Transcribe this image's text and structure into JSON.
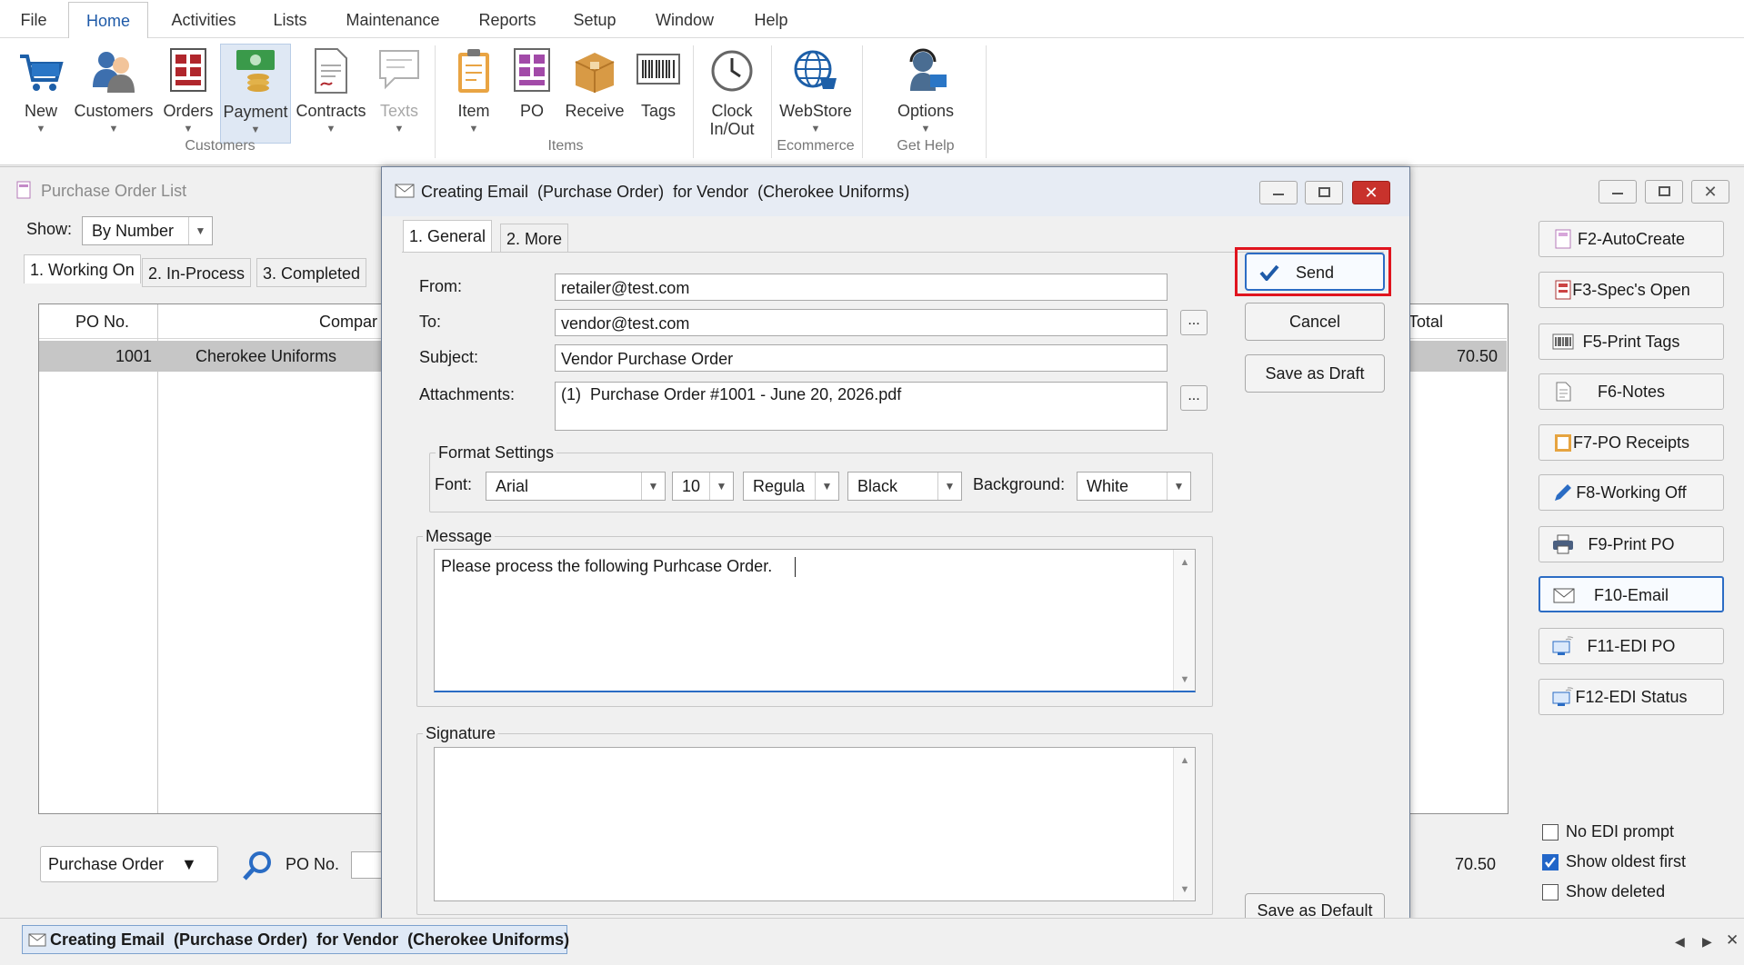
{
  "menu": {
    "items": [
      "File",
      "Home",
      "Activities",
      "Lists",
      "Maintenance",
      "Reports",
      "Setup",
      "Window",
      "Help"
    ],
    "active": "Home"
  },
  "ribbon": {
    "buttons": [
      {
        "label": "New",
        "icon": "cart-icon",
        "dropdown": true
      },
      {
        "label": "Customers",
        "icon": "customers-icon",
        "dropdown": true
      },
      {
        "label": "Orders",
        "icon": "orders-icon",
        "dropdown": true
      },
      {
        "label": "Payment",
        "icon": "payment-icon",
        "dropdown": true,
        "selected": true
      },
      {
        "label": "Contracts",
        "icon": "contracts-icon",
        "dropdown": true
      },
      {
        "label": "Texts",
        "icon": "texts-icon",
        "dropdown": true,
        "disabled": true
      },
      {
        "label": "Item",
        "icon": "item-icon",
        "dropdown": true
      },
      {
        "label": "PO",
        "icon": "po-icon",
        "dropdown": false
      },
      {
        "label": "Receive",
        "icon": "receive-icon",
        "dropdown": false
      },
      {
        "label": "Tags",
        "icon": "barcode-icon",
        "dropdown": false
      },
      {
        "label": "Clock",
        "label2": "In/Out",
        "icon": "clock-icon",
        "dropdown": false
      },
      {
        "label": "WebStore",
        "icon": "webstore-icon",
        "dropdown": true
      },
      {
        "label": "Options",
        "icon": "support-icon",
        "dropdown": true
      }
    ],
    "groups": [
      "Customers",
      "Items",
      "Ecommerce",
      "Get Help"
    ]
  },
  "po_list": {
    "title": "Purchase Order List",
    "show_label": "Show:",
    "show_value": "By Number",
    "tabs": [
      "1. Working On",
      "2. In-Process",
      "3. Completed"
    ],
    "columns": {
      "po_no": "PO No.",
      "company": "Compar",
      "total": "Total"
    },
    "rows": [
      {
        "po_no": "1001",
        "company": "Cherokee Uniforms",
        "total": "70.50"
      }
    ],
    "footer_total": "70.50",
    "search_type": "Purchase Order",
    "search_label": "PO No.",
    "side_buttons": [
      {
        "label": "F2-AutoCreate",
        "icon": "autocreate-icon"
      },
      {
        "label": "F3-Spec's Open",
        "icon": "spec-icon"
      },
      {
        "label": "F5-Print Tags",
        "icon": "barcode-icon"
      },
      {
        "label": "F6-Notes",
        "icon": "notes-icon"
      },
      {
        "label": "F7-PO Receipts",
        "icon": "receipts-icon"
      },
      {
        "label": "F8-Working Off",
        "icon": "pencil-icon"
      },
      {
        "label": "F9-Print PO",
        "icon": "printer-icon"
      },
      {
        "label": "F10-Email",
        "icon": "envelope-icon",
        "active": true
      },
      {
        "label": "F11-EDI PO",
        "icon": "edi-icon"
      },
      {
        "label": "F12-EDI Status",
        "icon": "edi-status-icon"
      }
    ],
    "checkboxes": [
      {
        "label": "No EDI prompt",
        "checked": false
      },
      {
        "label": "Show oldest first",
        "checked": true
      },
      {
        "label": "Show deleted",
        "checked": false
      }
    ]
  },
  "dialog": {
    "title": "Creating Email  (Purchase Order)  for Vendor  (Cherokee Uniforms)",
    "tabs": [
      "1. General",
      "2. More"
    ],
    "from_label": "From:",
    "from_value": "retailer@test.com",
    "to_label": "To:",
    "to_value": "vendor@test.com",
    "subject_label": "Subject:",
    "subject_value": "Vendor Purchase Order",
    "attachments_label": "Attachments:",
    "attachments_value": "(1)  Purchase Order #1001 - June 20, 2026.pdf",
    "ellipsis": "...",
    "format_legend": "Format Settings",
    "font_label": "Font:",
    "font_value": "Arial",
    "size_value": "10",
    "style_value": "Regula",
    "color_value": "Black",
    "background_label": "Background:",
    "background_value": "White",
    "message_legend": "Message",
    "message_value": "Please process the following Purhcase Order.",
    "signature_legend": "Signature",
    "signature_value": "",
    "buttons": {
      "send": "Send",
      "cancel": "Cancel",
      "draft": "Save as Draft",
      "default": "Save as Default"
    },
    "highlight_color": "#e0141e"
  },
  "taskbar": {
    "item": "Creating Email  (Purchase Order)  for Vendor  (Cherokee Uniforms)"
  }
}
